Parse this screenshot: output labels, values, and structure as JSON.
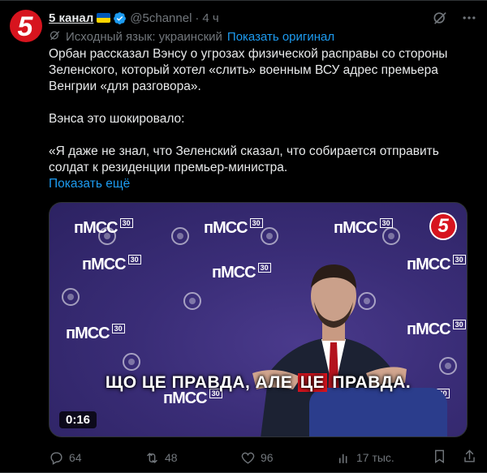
{
  "author": {
    "name": "5 канал",
    "handle": "@5channel",
    "dot": "·",
    "time": "4 ч",
    "avatar_text": "5"
  },
  "translation": {
    "label": "Исходный язык: украинский",
    "link": "Показать оригинал"
  },
  "body": {
    "p1": "Орбан рассказал Вэнсу о угрозах физической расправы со стороны Зеленского, который хотел «слить» военным ВСУ адрес премьера Венгрии «для разговора».",
    "p2": "Вэнса это шокировало:",
    "p3": "«Я даже не знал, что Зеленский сказал, что собирается отправить солдат к резиденции премьер-министра.",
    "show_more": "Показать ещё"
  },
  "media": {
    "logo": "пMCC",
    "logo_badge": "30",
    "channel_badge": "5",
    "subtitle_a": "ЩО ЦЕ ПРАВДА, АЛЕ ",
    "subtitle_hl": "ЦЕ",
    "subtitle_b": " ПРАВДА.",
    "duration": "0:16"
  },
  "stats": {
    "replies": "64",
    "reposts": "48",
    "likes": "96",
    "views": "17 тыс."
  },
  "colors": {
    "accent": "#1d9bf0",
    "brand": "#d7141e",
    "muted": "#71767b",
    "background": "#000000"
  }
}
